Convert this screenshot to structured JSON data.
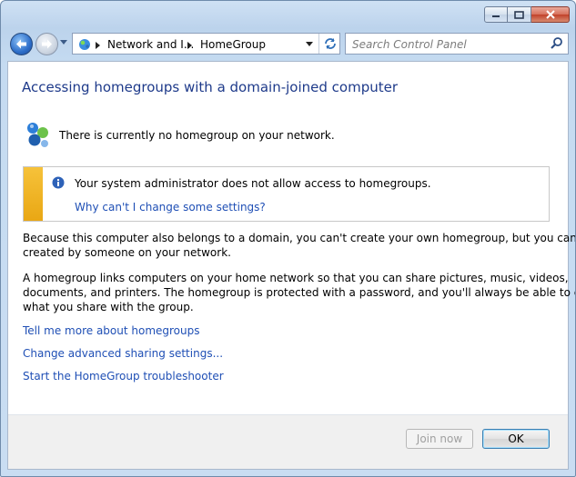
{
  "window": {
    "controls": {
      "minimize_icon": "minimize-icon",
      "maximize_icon": "maximize-icon",
      "close_icon": "close-icon"
    }
  },
  "navigation": {
    "back_icon": "back-arrow-icon",
    "forward_icon": "forward-arrow-icon",
    "breadcrumb": [
      "Network and I...",
      "HomeGroup"
    ],
    "search_placeholder": "Search Control Panel"
  },
  "page": {
    "title": "Accessing homegroups with a domain-joined computer",
    "status": "There is currently no homegroup on your network.",
    "info": {
      "message": "Your system administrator does not allow access to homegroups.",
      "link": "Why can't I change some settings?"
    },
    "paragraph1": [
      "Because this computer also belongs to a domain, you can't create your own homegroup, but you can join one",
      "created by someone on your network."
    ],
    "paragraph2": [
      "A homegroup links computers on your home network so that you can share pictures, music, videos,",
      "documents, and printers. The homegroup is protected with a password, and you'll always be able to choose",
      "what you share with the group."
    ],
    "links": [
      "Tell me more about homegroups",
      "Change advanced sharing settings...",
      "Start the HomeGroup troubleshooter"
    ]
  },
  "footer": {
    "join_label": "Join now",
    "ok_label": "OK"
  },
  "colors": {
    "link": "#1f4fb5",
    "title": "#1e3a8a",
    "warning_bar": "#f0b323"
  }
}
